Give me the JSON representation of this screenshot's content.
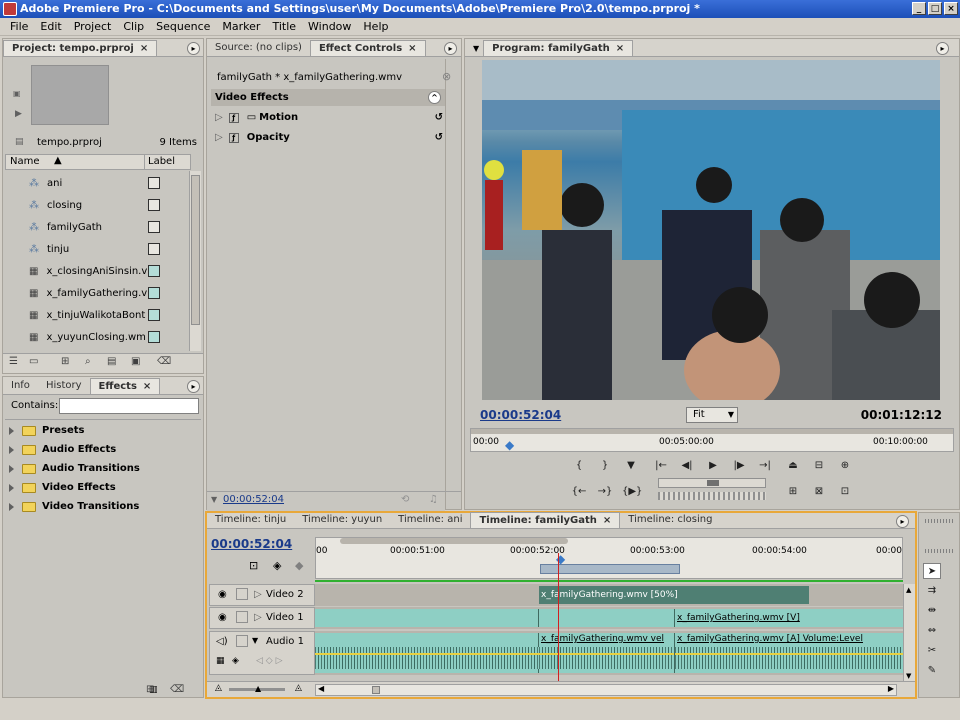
{
  "app": {
    "title": "Adobe Premiere Pro - C:\\Documents and Settings\\user\\My Documents\\Adobe\\Premiere Pro\\2.0\\tempo.prproj *"
  },
  "menu": [
    "File",
    "Edit",
    "Project",
    "Clip",
    "Sequence",
    "Marker",
    "Title",
    "Window",
    "Help"
  ],
  "project": {
    "tab": "Project: tempo.prproj",
    "file": "tempo.prproj",
    "count": "9 Items",
    "col_name": "Name",
    "col_label": "Label",
    "items": [
      "ani",
      "closing",
      "familyGath",
      "tinju",
      "x_closingAniSinsin.v",
      "x_familyGathering.v",
      "x_tinjuWalikotaBont",
      "x_yuyunClosing.wm"
    ]
  },
  "effects_panel": {
    "tabs": [
      "Info",
      "History",
      "Effects"
    ],
    "contains_label": "Contains:",
    "folders": [
      "Presets",
      "Audio Effects",
      "Audio Transitions",
      "Video Effects",
      "Video Transitions"
    ]
  },
  "effect_controls": {
    "tabs": [
      "Source: (no clips)",
      "Effect Controls"
    ],
    "clip_title": "familyGath * x_familyGathering.wmv",
    "section": "Video Effects",
    "effects": [
      "Motion",
      "Opacity"
    ],
    "timecode": "00:00:52:04"
  },
  "program": {
    "tab": "Program: familyGath",
    "timecode_current": "00:00:52:04",
    "fit_label": "Fit",
    "timecode_total": "00:01:12:12",
    "ruler": [
      "00:00",
      "00:05:00:00",
      "00:10:00:00"
    ]
  },
  "timeline": {
    "tabs": [
      "Timeline: tinju",
      "Timeline: yuyun",
      "Timeline: ani",
      "Timeline: familyGath",
      "Timeline: closing"
    ],
    "active_tab": "Timeline: familyGath",
    "timecode": "00:00:52:04",
    "ruler": [
      "00",
      "00:00:51:00",
      "00:00:52:00",
      "00:00:53:00",
      "00:00:54:00",
      "00:00"
    ],
    "tracks": [
      "Video 2",
      "Video 1",
      "Audio 1"
    ],
    "clips": {
      "v2": "x_familyGathering.wmv [50%]",
      "v1": "x_familyGathering.wmv [V]",
      "a1_left": "x_familyGathering.wmv vel",
      "a1_right": "x_familyGathering.wmv [A] Volume:Level"
    }
  },
  "colors": {
    "clip_teal": "#8ecfc4",
    "clip_dark": "#4f7f73",
    "timecode_blue": "#1a3a8a",
    "panel_orange": "#e8a83a",
    "playhead_red": "#d02020"
  }
}
